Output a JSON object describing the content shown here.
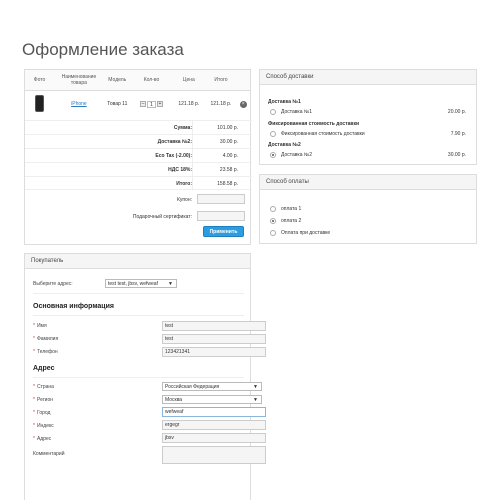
{
  "page_title": "Оформление заказа",
  "cart": {
    "headers": [
      "Фото",
      "Наименование товара",
      "Модель",
      "Кол-во",
      "Цена",
      "Итого"
    ],
    "item": {
      "name": "iPhone",
      "model": "Товар 11",
      "qty": "1",
      "price": "121.18 р.",
      "total": "121.18 р.",
      "minus": "–",
      "plus": "+",
      "delete": "×"
    },
    "totals": [
      {
        "label": "Сумма:",
        "value": "101.00 р."
      },
      {
        "label": "Доставка №2:",
        "value": "30.00 р."
      },
      {
        "label": "Eco Tax (-2.00):",
        "value": "4.00 р."
      },
      {
        "label": "НДС 18%:",
        "value": "23.58 р."
      },
      {
        "label": "Итого:",
        "value": "158.58 р."
      }
    ],
    "coupon_label": "Купон:",
    "certificate_label": "Подарочный сертификат:",
    "apply_label": "Применить"
  },
  "delivery": {
    "title": "Способ доставки",
    "group1": "Доставка №1",
    "opt1": {
      "label": "Доставка №1",
      "price": "20.00 р."
    },
    "group2": "Фиксированная стоимость доставки",
    "opt2": {
      "label": "Фиксированная стоимость доставки",
      "price": "7.90 р."
    },
    "group3": "Доставка №2",
    "opt3": {
      "label": "Доставка №2",
      "price": "30.00 р."
    }
  },
  "payment": {
    "title": "Способ оплаты",
    "opt1": "оплата 1",
    "opt2": "оплата 2",
    "opt3": "Оплата при доставке"
  },
  "customer": {
    "title": "Покупатель",
    "address_label": "Выберите адрес:",
    "address_value": "test test, jbsv, wefweaf",
    "basic_title": "Основная информация",
    "first_name_label": "Имя",
    "first_name_value": "test",
    "last_name_label": "Фамилия",
    "last_name_value": "test",
    "phone_label": "Телефон",
    "phone_value": "123421341",
    "address_title": "Адрес",
    "country_label": "Страна",
    "country_value": "Российская Федерация",
    "region_label": "Регион",
    "region_value": "Москва",
    "city_label": "Город",
    "city_value": "wefweaf",
    "zip_label": "Индекс",
    "zip_value": "ergegr",
    "addr_label": "Адрес",
    "addr_value": "jbsv",
    "comment_label": "Комментарий",
    "required_mark": "*",
    "select_arrow": "▼"
  }
}
